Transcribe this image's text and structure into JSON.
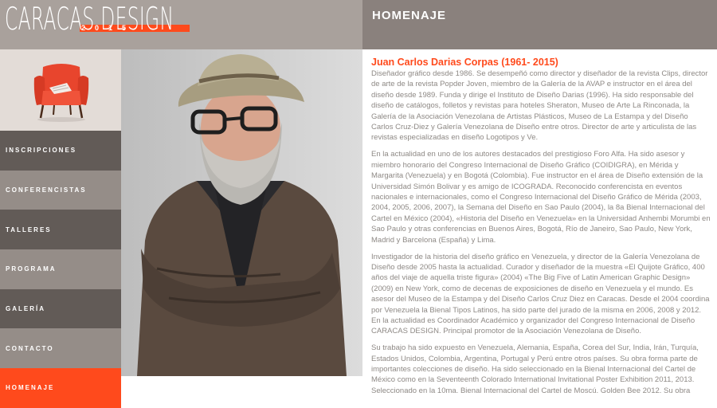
{
  "logo": {
    "text": "CARACAS DESIGN",
    "year": "2015"
  },
  "page": {
    "title": "HOMENAJE"
  },
  "sidebar": {
    "items": [
      {
        "label": "INSCRIPCIONES"
      },
      {
        "label": "CONFERENCISTAS"
      },
      {
        "label": "TALLERES"
      },
      {
        "label": "PROGRAMA"
      },
      {
        "label": "GALERÍA"
      },
      {
        "label": "CONTACTO"
      },
      {
        "label": "HOMENAJE"
      }
    ]
  },
  "main": {
    "name": "Juan Carlos Darias Corpas (1961- 2015)",
    "paragraphs": [
      "Diseñador gráfico desde 1986. Se desempeñó como director y diseñador de la revista Clips, director de arte de la revista Popder Joven, miembro de la Galería de la AVAP e instructor en el área del diseño desde 1989. Funda y dirige el Instituto de Diseño Darias (1996). Ha sido responsable del diseño de catálogos, folletos y revistas para hoteles Sheraton, Museo de Arte La Rinconada, la Galería de la Asociación Venezolana de Artistas Plásticos, Museo de La Estampa y del Diseño Carlos Cruz-Diez y Galería Venezolana de Diseño entre otros. Director de arte y articulista de las revistas especializadas en diseño Logotipos y Ve.",
      "En la actualidad en uno de los autores destacados del prestigioso Foro Alfa. Ha sido asesor y miembro honorario del Congreso Internacional de Diseño Gráfico (COIDIGRA), en Mérida y Margarita (Venezuela) y en Bogotá (Colombia). Fue instructor en el área de Diseño extensión de la Universidad Simón Bolivar y es amigo de ICOGRADA. Reconocido conferencista en eventos nacionales e internacionales, como el Congreso Internacional del Diseño Gráfico de Mérida (2003, 2004, 2005, 2006, 2007), la Semana del Diseño en Sao Paulo (2004), la 8a Bienal Internacional del Cartel en México (2004), «Historia del Diseño en Venezuela» en la Universidad Anhembi Morumbi en Sao Paulo y otras conferencias en Buenos Aires, Bogotá, Río de Janeiro, Sao Paulo, New York, Madrid y Barcelona (España) y Lima.",
      "Investigador de la historia del diseño gráfico en Venezuela, y director de la Galería Venezolana de Diseño desde 2005 hasta la actualidad. Curador y diseñador de la muestra «El Quijote Gráfico, 400 años del viaje de aquella triste figura» (2004) «The Big Five of Latin American Graphic Design» (2009) en New York, como de decenas de exposiciones de diseño en Venezuela y el mundo. Es asesor del Museo de la Estampa y del Diseño Carlos Cruz Diez en Caracas. Desde el 2004 coordina por Venezuela la Bienal Tipos Latinos, ha sido parte del jurado de la misma en 2006, 2008 y 2012. En la actualidad es Coordinador Académico y organizador del Congreso Internacional de Diseño CARACAS DESIGN. Principal promotor de la Asociación Venezolana de Diseño.",
      "Su trabajo ha sido expuesto en Venezuela, Alemania, España, Corea del Sur, India, Irán, Turquía, Estados Unidos, Colombia, Argentina, Portugal y Perú entre otros países. Su obra forma parte de importantes colecciones de diseño. Ha sido seleccionado en la Bienal Internacional del Cartel de México como en la Seventeenth Colorado International Invitational Poster Exhibition 2011, 2013. Seleccionado en la 10ma. Bienal Internacional del Cartel de Moscú. Golden Bee 2012. Su obra"
    ]
  },
  "colors": {
    "accent": "#ff4a1c",
    "header_left": "#a9a19c",
    "header_right": "#8a817d",
    "nav_dark": "#625b57",
    "nav_light": "#958d88",
    "body_text": "#8e8985"
  }
}
